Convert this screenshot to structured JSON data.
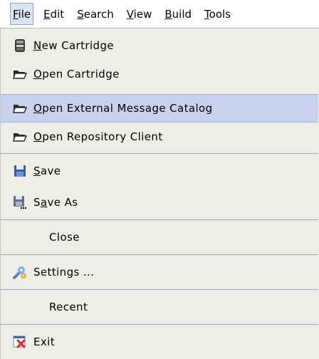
{
  "menubar": {
    "items": [
      {
        "mnemonic": "F",
        "rest": "ile"
      },
      {
        "mnemonic": "E",
        "rest": "dit"
      },
      {
        "mnemonic": "S",
        "rest": "earch"
      },
      {
        "mnemonic": "V",
        "rest": "iew"
      },
      {
        "mnemonic": "B",
        "rest": "uild"
      },
      {
        "mnemonic": "T",
        "rest": "ools"
      }
    ]
  },
  "file_menu": {
    "new_cartridge": {
      "mn": "N",
      "rest": "ew Cartridge",
      "icon": "cartridge-icon"
    },
    "open_cartridge": {
      "mn": "O",
      "rest": "pen Cartridge",
      "icon": "folder-open-icon"
    },
    "open_external_catalog": {
      "mn": "O",
      "rest": "pen External Message Catalog",
      "icon": "folder-open-icon"
    },
    "open_repository_client": {
      "mn": "O",
      "rest": "pen Repository Client",
      "icon": "folder-open-icon"
    },
    "save": {
      "mn": "S",
      "rest": "ave",
      "icon": "floppy-disk-icon"
    },
    "save_as": {
      "pre": "S",
      "mn": "a",
      "rest": "ve As",
      "icon": "floppy-disk-saveas-icon"
    },
    "close": {
      "label": "Close"
    },
    "settings": {
      "label": "Settings ...",
      "icon": "settings-icon"
    },
    "recent": {
      "label": "Recent"
    },
    "exit": {
      "label": "Exit",
      "icon": "exit-icon"
    }
  },
  "colors": {
    "menu_background": "#eeede6",
    "highlight": "#c7d3ec",
    "separator": "#9aa9c8"
  }
}
